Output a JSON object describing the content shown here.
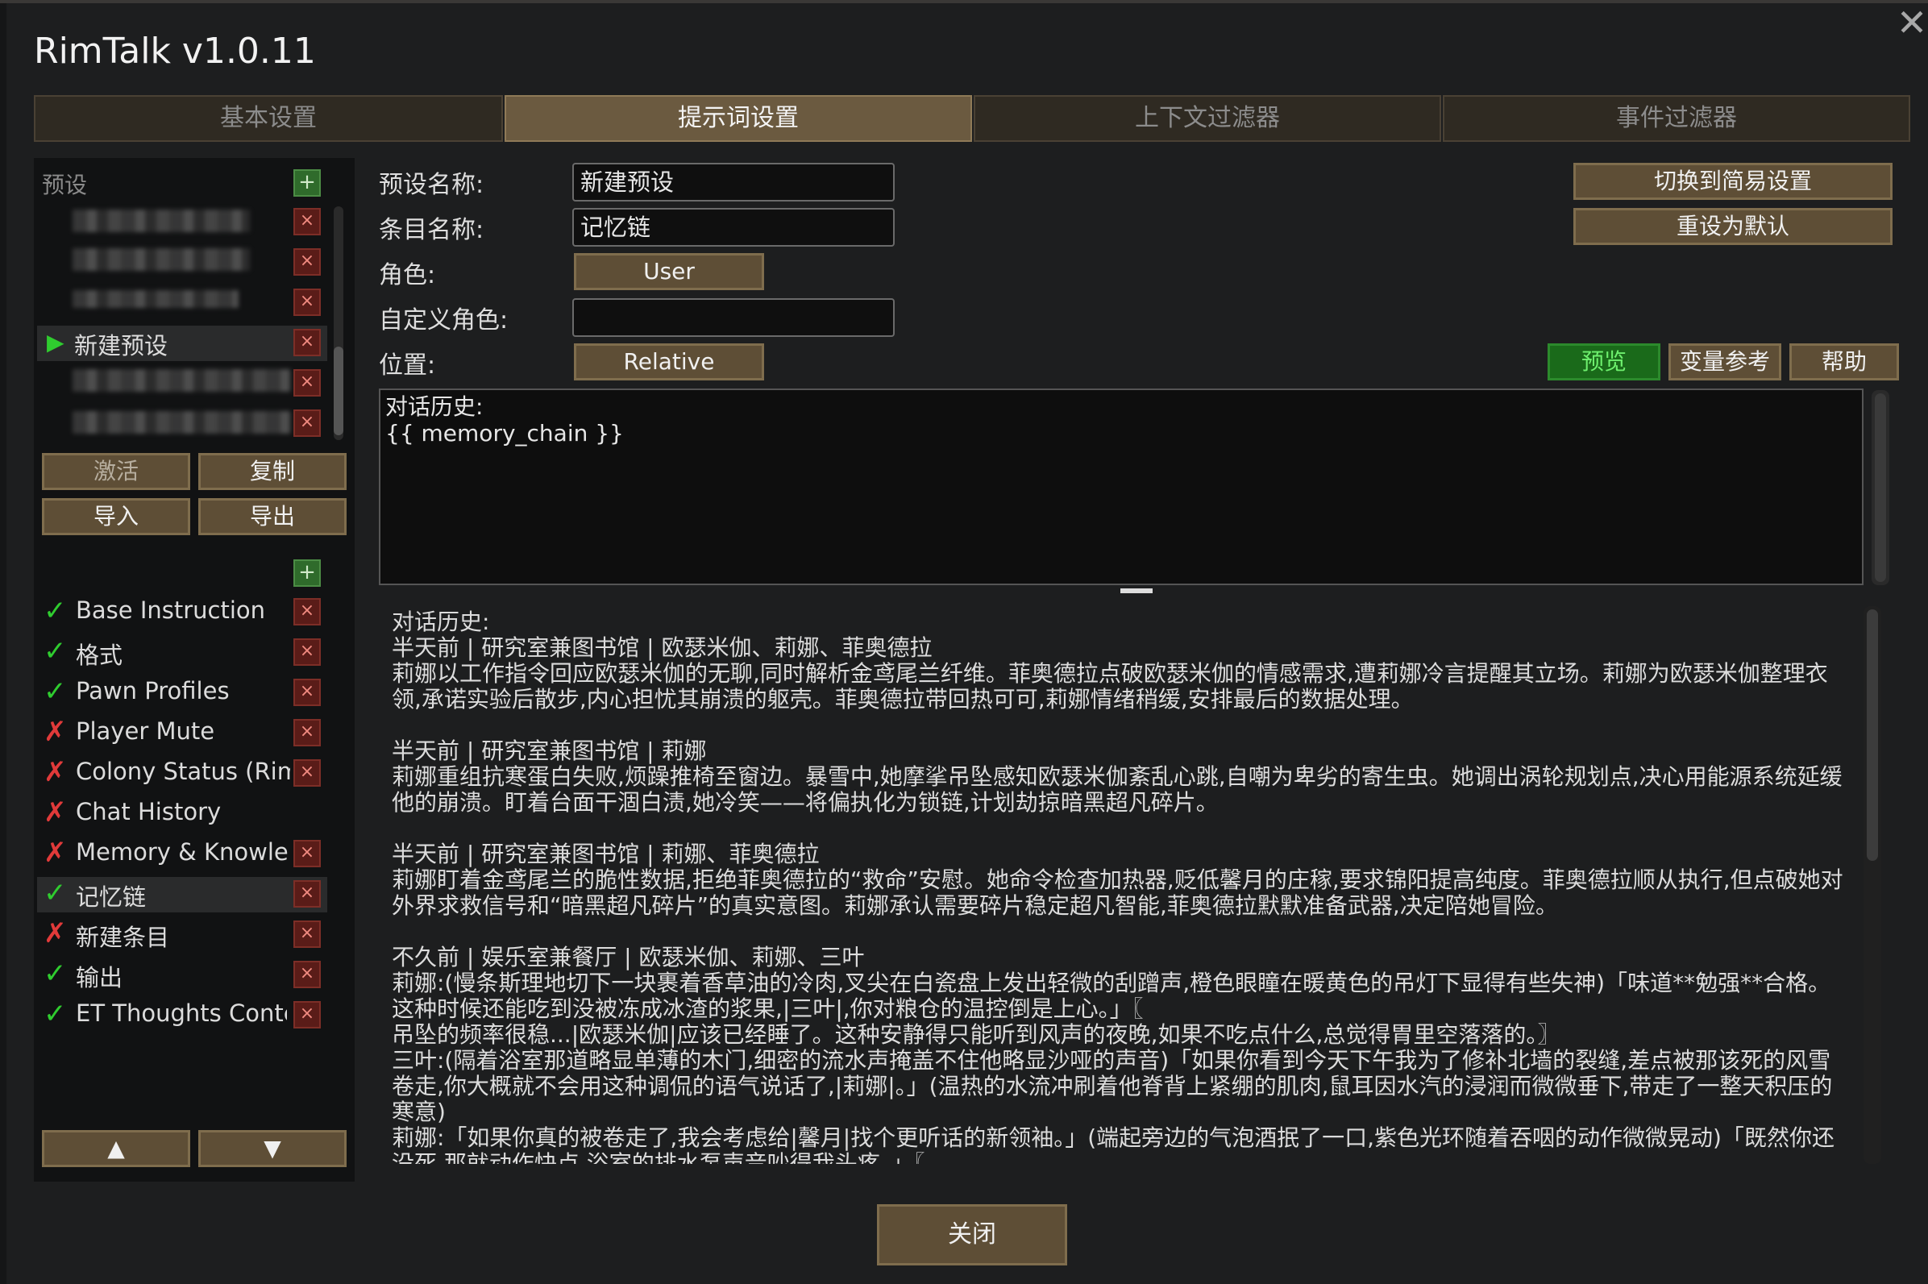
{
  "window": {
    "title": "RimTalk v1.0.11",
    "close_icon": "✕"
  },
  "tabs": [
    {
      "label": "基本设置",
      "active": false
    },
    {
      "label": "提示词设置",
      "active": true
    },
    {
      "label": "上下文过滤器",
      "active": false
    },
    {
      "label": "事件过滤器",
      "active": false
    }
  ],
  "presets": {
    "header": "预设",
    "add_icon": "+",
    "del_icon": "×",
    "active_marker": "▶",
    "active_label": "新建预设",
    "buttons": {
      "activate": "激活",
      "copy": "复制",
      "import": "导入",
      "export": "导出"
    }
  },
  "entries": {
    "add_icon": "+",
    "del_icon": "×",
    "check_icon": "✓",
    "cross_icon": "✗",
    "items": [
      {
        "label": "Base Instruction",
        "enabled": true
      },
      {
        "label": "格式",
        "enabled": true
      },
      {
        "label": "Pawn Profiles",
        "enabled": true
      },
      {
        "label": "Player Mute",
        "enabled": false
      },
      {
        "label": "Colony Status (RimTa",
        "enabled": false
      },
      {
        "label": "Chat History",
        "enabled": false
      },
      {
        "label": "Memory & Knowledg",
        "enabled": false
      },
      {
        "label": "记忆链",
        "enabled": true
      },
      {
        "label": "新建条目",
        "enabled": false
      },
      {
        "label": "输出",
        "enabled": true
      },
      {
        "label": "ET Thoughts Contex",
        "enabled": true
      }
    ],
    "up_icon": "▲",
    "down_icon": "▼"
  },
  "form": {
    "preset_name_label": "预设名称:",
    "preset_name_value": "新建预设",
    "entry_name_label": "条目名称:",
    "entry_name_value": "记忆链",
    "role_label": "角色:",
    "role_value": "User",
    "custom_role_label": "自定义角色:",
    "custom_role_value": "",
    "position_label": "位置:",
    "position_value": "Relative"
  },
  "side_buttons": {
    "simple_mode": "切换到简易设置",
    "reset": "重设为默认"
  },
  "editor_buttons": {
    "preview": "预览",
    "variables": "变量参考",
    "help": "帮助"
  },
  "editor": {
    "content": "对话历史:\n{{ memory_chain }}"
  },
  "preview_text": [
    "对话历史:",
    "半天前 | 研究室兼图书馆 | 欧瑟米伽、莉娜、菲奥德拉",
    "莉娜以工作指令回应欧瑟米伽的无聊,同时解析金鸢尾兰纤维。菲奥德拉点破欧瑟米伽的情感需求,遭莉娜冷言提醒其立场。莉娜为欧瑟米伽整理衣领,承诺实验后散步,内心担忧其崩溃的躯壳。菲奥德拉带回热可可,莉娜情绪稍缓,安排最后的数据处理。",
    "",
    "半天前 | 研究室兼图书馆 | 莉娜",
    "莉娜重组抗寒蛋白失败,烦躁推椅至窗边。暴雪中,她摩挲吊坠感知欧瑟米伽紊乱心跳,自嘲为卑劣的寄生虫。她调出涡轮规划点,决心用能源系统延缓他的崩溃。盯着台面干涸白渍,她冷笑——将偏执化为锁链,计划劫掠暗黑超凡碎片。",
    "",
    "半天前 | 研究室兼图书馆 | 莉娜、菲奥德拉",
    "莉娜盯着金鸢尾兰的脆性数据,拒绝菲奥德拉的“救命”安慰。她命令检查加热器,贬低馨月的庄稼,要求锦阳提高纯度。菲奥德拉顺从执行,但点破她对外界求救信号和“暗黑超凡碎片”的真实意图。莉娜承认需要碎片稳定超凡智能,菲奥德拉默默准备武器,决定陪她冒险。",
    "",
    "不久前 | 娱乐室兼餐厅 | 欧瑟米伽、莉娜、三叶",
    "莉娜:(慢条斯理地切下一块裹着香草油的冷肉,叉尖在白瓷盘上发出轻微的刮蹭声,橙色眼瞳在暖黄色的吊灯下显得有些失神)「味道**勉强**合格。这种时候还能吃到没被冻成冰渣的浆果,|三叶|,你对粮仓的温控倒是上心。」〖",
    "吊坠的频率很稳...|欧瑟米伽|应该已经睡了。这种安静得只能听到风声的夜晚,如果不吃点什么,总觉得胃里空落落的。〗",
    "三叶:(隔着浴室那道略显单薄的木门,细密的流水声掩盖不住他略显沙哑的声音)「如果你看到今天下午我为了修补北墙的裂缝,差点被那该死的风雪卷走,你大概就不会用这种调侃的语气说话了,|莉娜|。」(温热的水流冲刷着他脊背上紧绷的肌肉,鼠耳因水汽的浸润而微微垂下,带走了一整天积压的寒意)",
    "莉娜:「如果你真的被卷走了,我会考虑给|馨月|找个更听话的新领袖。」(端起旁边的气泡酒抿了一口,紫色光环随着吞咽的动作微微晃动)「既然你还没死,那就动作快点,浴室的排水泵声音吵得我头疼。」〖"
  ],
  "footer": {
    "close": "关闭"
  }
}
